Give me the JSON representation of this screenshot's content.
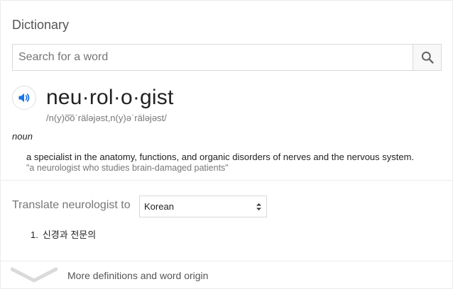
{
  "panel": {
    "title": "Dictionary"
  },
  "search": {
    "placeholder": "Search for a word",
    "value": "",
    "button_icon": "search-icon"
  },
  "entry": {
    "speaker_icon": "speaker-icon",
    "word": "neu·rol·o·gist",
    "phonetic": "/n(y)o͞oˈräləjəst,n(y)əˈräləjəst/",
    "part_of_speech": "noun",
    "definition": "a specialist in the anatomy, functions, and organic disorders of nerves and the nervous system.",
    "example": "\"a neurologist who studies brain-damaged patients\""
  },
  "translate": {
    "label": "Translate neurologist to",
    "selected_language": "Korean",
    "results": [
      {
        "number": "1.",
        "text": "신경과 전문의"
      }
    ]
  },
  "footer": {
    "more_label": "More definitions and word origin",
    "chevron_icon": "chevron-down-icon"
  },
  "colors": {
    "accent_blue": "#1a73e8",
    "text_primary": "#222222",
    "text_secondary": "#777777",
    "border": "#d9d9d9"
  }
}
